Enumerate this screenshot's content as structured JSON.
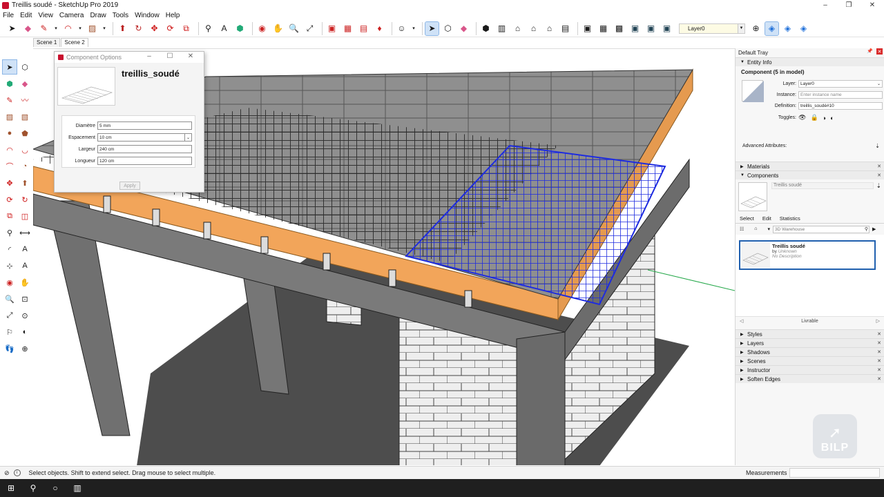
{
  "window": {
    "title": "Treillis soudé - SketchUp Pro 2019",
    "controls": [
      "–",
      "❐",
      "✕"
    ]
  },
  "menu": [
    "File",
    "Edit",
    "View",
    "Camera",
    "Draw",
    "Tools",
    "Window",
    "Help"
  ],
  "toolbar": {
    "icons": [
      "select-icon",
      "eraser-icon",
      "pencil-icon",
      "dropdown",
      "shapes-icon",
      "dropdown",
      "paint-icon",
      "dropdown",
      "push-pull-icon",
      "follow-me-icon",
      "move-icon",
      "rotate-icon",
      "offset-icon",
      "tape-icon",
      "text-icon",
      "paint-bucket-icon",
      "orbit-icon",
      "pan-icon",
      "zoom-icon",
      "zoom-extents-icon",
      "warehouse-icon",
      "extension-icon",
      "ruby-icon",
      "ruby2-icon",
      "person-icon",
      "dropdown",
      "select2-icon",
      "make-component-icon",
      "eraser2-icon",
      "iso-icon",
      "front-icon",
      "home-icon",
      "top-icon",
      "right-icon",
      "back-icon",
      "left-icon",
      "xray-icon",
      "wire-icon",
      "hidden-icon",
      "shaded-icon",
      "textured-icon",
      "mono-icon"
    ],
    "layer": "Layer0"
  },
  "scenes": [
    "Scene 1",
    "Scene 2"
  ],
  "component_options": {
    "title": "Component Options",
    "name": "treillis_soudé",
    "fields": [
      {
        "label": "Diamètre",
        "value": "5 mm",
        "dropdown": false
      },
      {
        "label": "Espacement",
        "value": "10 cm",
        "dropdown": true
      },
      {
        "label": "Largeur",
        "value": "240 cm",
        "dropdown": false
      },
      {
        "label": "Longueur",
        "value": "120 cm",
        "dropdown": false
      }
    ],
    "apply": "Apply"
  },
  "tray": {
    "title": "Default Tray",
    "entity_info": {
      "header": "Entity Info",
      "component_title": "Component (5 in model)",
      "layer_label": "Layer:",
      "layer_value": "Layer0",
      "instance_label": "Instance:",
      "instance_placeholder": "Enter instance name",
      "definition_label": "Definition:",
      "definition_value": "treillis_soudé#10",
      "toggles_label": "Toggles:",
      "advanced": "Advanced Attributes:"
    },
    "materials": "Materials",
    "components": {
      "header": "Components",
      "selected_name": "Treillis soudé",
      "tabs": [
        "Select",
        "Edit",
        "Statistics"
      ],
      "search_placeholder": "3D Warehouse",
      "result": {
        "name": "Treillis soudé",
        "by_prefix": "by",
        "author": "Unknown",
        "desc": "No Description"
      },
      "folder": "Livrable"
    },
    "collapsed": [
      "Styles",
      "Layers",
      "Shadows",
      "Scenes",
      "Instructor",
      "Soften Edges"
    ],
    "watermark": "BILP"
  },
  "status": {
    "text": "Select objects. Shift to extend select. Drag mouse to select multiple.",
    "measurements": "Measurements"
  },
  "colors": {
    "selection": "#1d2be0",
    "timber": "#f2a55a",
    "concrete": "#6d6d6d",
    "block": "#ececec"
  }
}
